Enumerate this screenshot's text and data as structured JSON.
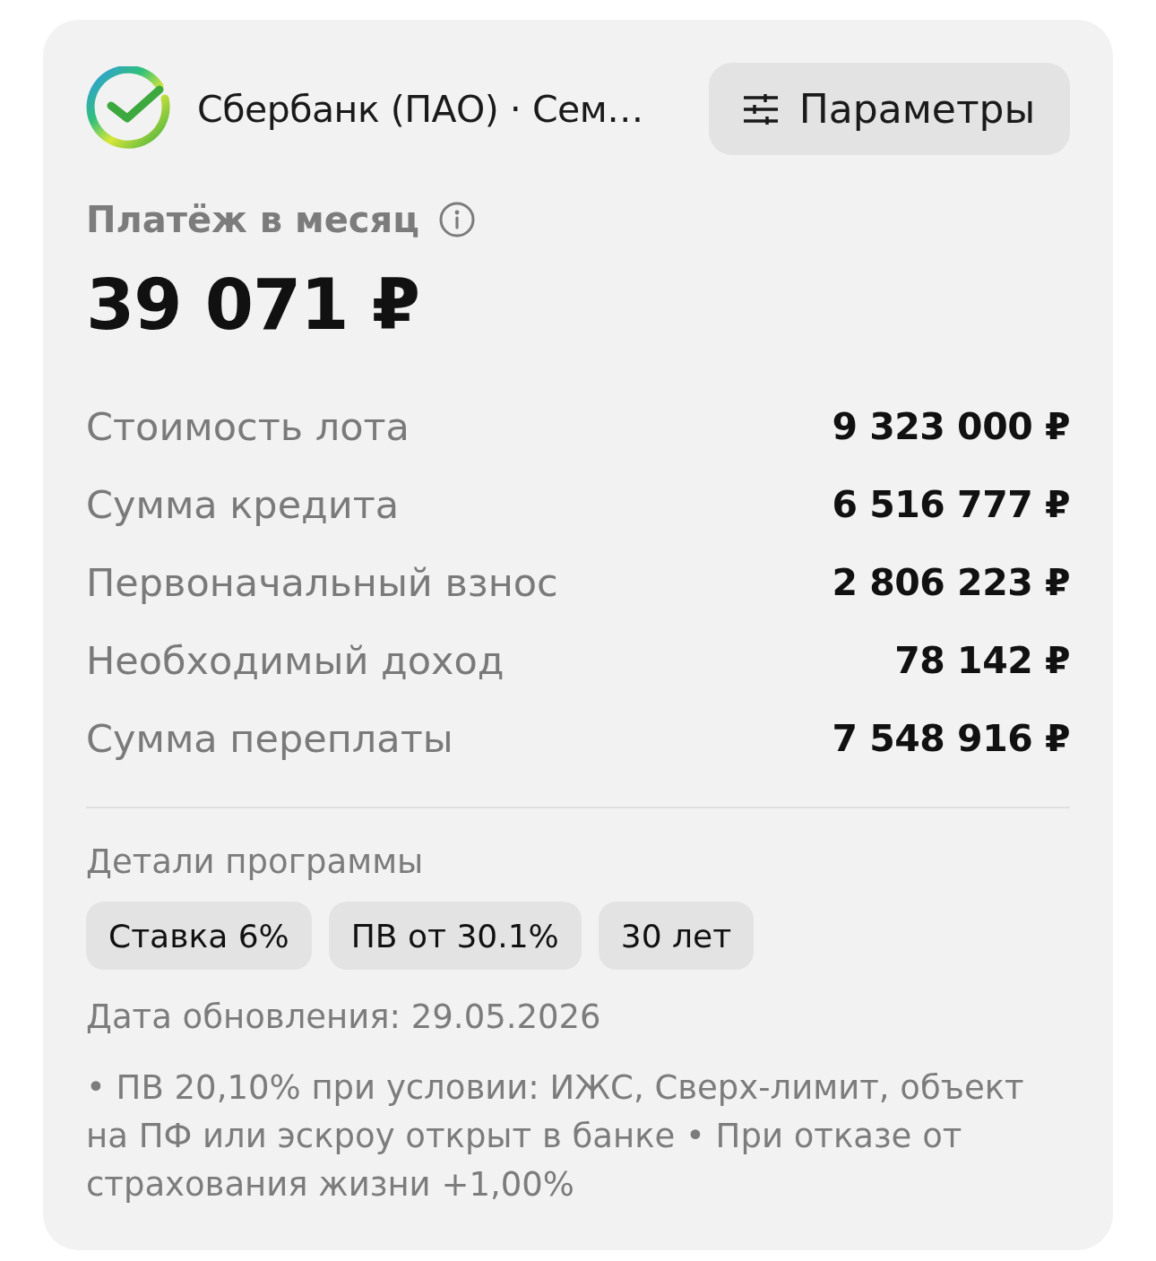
{
  "header": {
    "title": "Сбербанк (ПАО) · Сем…",
    "button": "Параметры"
  },
  "payment": {
    "label": "Платёж в месяц",
    "amount": "39 071 ₽"
  },
  "rows": [
    {
      "label": "Стоимость лота",
      "value": "9 323 000 ₽"
    },
    {
      "label": "Сумма кредита",
      "value": "6 516 777 ₽"
    },
    {
      "label": "Первоначальный взнос",
      "value": "2 806 223 ₽"
    },
    {
      "label": "Необходимый доход",
      "value": "78 142 ₽"
    },
    {
      "label": "Сумма переплаты",
      "value": "7 548 916 ₽"
    }
  ],
  "details": {
    "title": "Детали программы",
    "chips": [
      "Ставка 6%",
      "ПВ от 30.1%",
      "30 лет"
    ],
    "updated": "Дата обновления: 29.05.2026",
    "note": "• ПВ 20,10% при условии: ИЖС, Сверх-лимит, объект на ПФ или эскроу открыт в банке • При отказе от страхования жизни +1,00%"
  }
}
